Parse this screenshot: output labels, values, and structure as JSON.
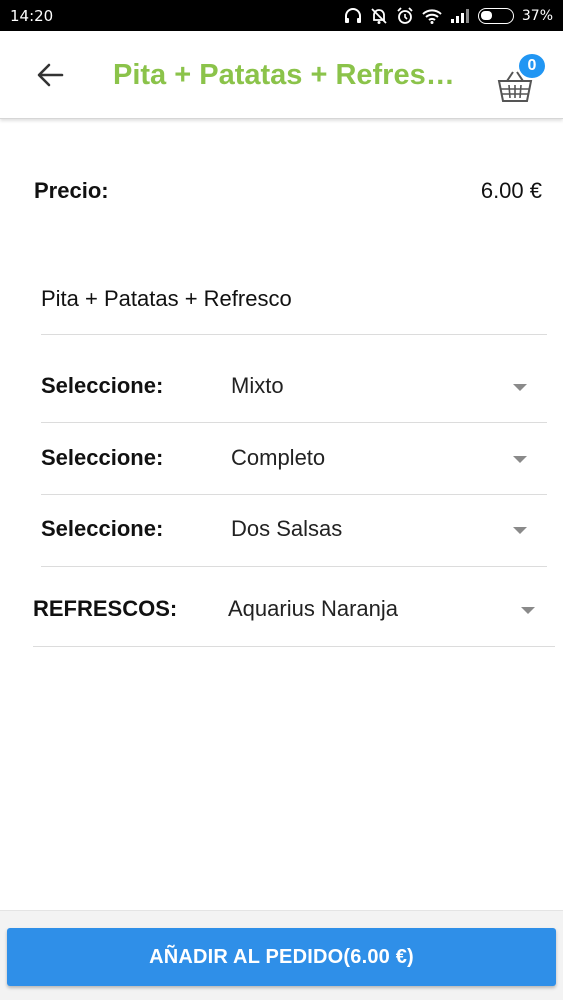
{
  "status_bar": {
    "time": "14:20",
    "battery_percent": "37%"
  },
  "app_bar": {
    "title": "Pita + Patatas + Refresco",
    "cart_count": "0"
  },
  "price": {
    "label": "Precio:",
    "value": "6.00 €"
  },
  "product": {
    "name": "Pita + Patatas + Refresco"
  },
  "options": [
    {
      "label": "Seleccione:",
      "value": "Mixto"
    },
    {
      "label": "Seleccione:",
      "value": "Completo"
    },
    {
      "label": "Seleccione:",
      "value": "Dos Salsas"
    },
    {
      "label": "REFRESCOS:",
      "value": "Aquarius Naranja"
    }
  ],
  "add_button": {
    "label": "AÑADIR AL PEDIDO(6.00 €)"
  },
  "colors": {
    "title_green": "#8bc34a",
    "accent_blue": "#2f8fe8",
    "badge_blue": "#2196f3"
  },
  "icons": [
    "headphones-icon",
    "notifications-off-icon",
    "alarm-icon",
    "wifi-icon",
    "signal-icon",
    "battery-icon",
    "arrow-back-icon",
    "shopping-basket-icon",
    "dropdown-arrow-icon"
  ]
}
